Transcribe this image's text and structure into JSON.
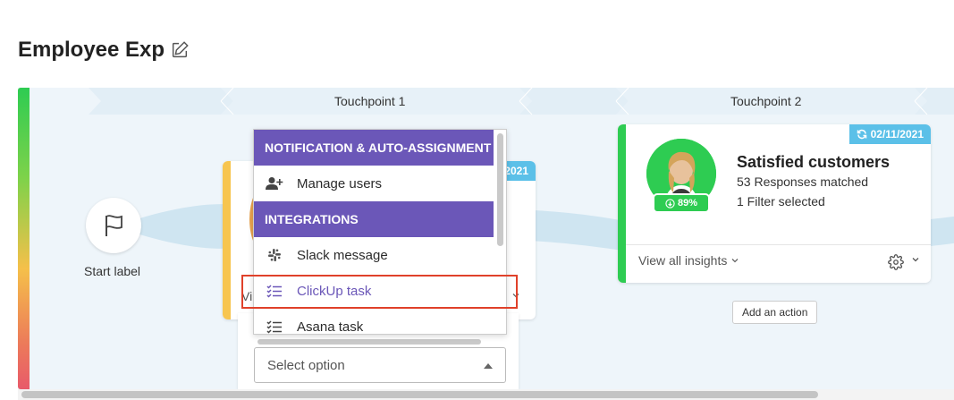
{
  "page": {
    "title": "Employee Exp"
  },
  "journey": {
    "touchpoints": [
      "Touchpoint 1",
      "Touchpoint 2"
    ],
    "start_label": "Start label",
    "colors": {
      "accent_purple": "#6b57b8",
      "green": "#2ecc52",
      "yellow": "#f7c54f",
      "date_blue": "#5bc0e8",
      "highlight_red": "#e0412a"
    }
  },
  "card1": {
    "date_fragment": "2021",
    "view_fragment": "Vi"
  },
  "card2": {
    "date": "02/11/2021",
    "score": "89%",
    "title": "Satisfied customers",
    "responses": "53 Responses matched",
    "filters": "1 Filter selected",
    "view_insights": "View all insights",
    "add_action": "Add an action"
  },
  "dropdown": {
    "group1": "NOTIFICATION & AUTO-ASSIGNMENT",
    "group2": "INTEGRATIONS",
    "items": [
      {
        "label": "Manage users",
        "icon": "add-user-icon"
      },
      {
        "label": "Slack message",
        "icon": "slack-icon"
      },
      {
        "label": "ClickUp task",
        "icon": "checklist-icon"
      },
      {
        "label": "Asana task",
        "icon": "checklist-icon"
      }
    ]
  },
  "select": {
    "placeholder": "Select option"
  }
}
